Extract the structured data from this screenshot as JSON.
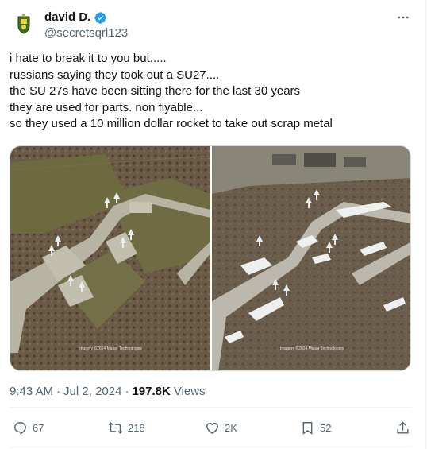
{
  "post": {
    "author_name": "david D.",
    "author_handle": "@secretsqrl123",
    "verified": true,
    "text_lines": [
      "i hate to break it to you but.....",
      "russians saying they took out a SU27....",
      "the SU 27s have been sitting there for the last 30 years",
      "they are used for parts. non flyable...",
      "so they used a 10 million dollar rocket to take out scrap metal"
    ],
    "media": {
      "left_caption": "Imagery ©2024 Maxar Technologies",
      "right_caption": "Imagery ©2024 Maxar Technologies"
    },
    "time": "9:43 AM",
    "separator": "·",
    "date": "Jul 2, 2024",
    "views_count": "197.8K",
    "views_label": "Views"
  },
  "actions": {
    "replies": "67",
    "reposts": "218",
    "likes": "2K",
    "bookmarks": "52"
  },
  "icons": {
    "avatar": "avatar-emblem-icon",
    "verified": "verified-badge-icon",
    "more": "more-icon",
    "reply": "reply-icon",
    "repost": "repost-icon",
    "like": "heart-icon",
    "bookmark": "bookmark-icon",
    "share": "share-icon"
  },
  "colors": {
    "verified": "#1d9bf0",
    "secondary_text": "#536471",
    "primary_text": "#0f1419"
  }
}
